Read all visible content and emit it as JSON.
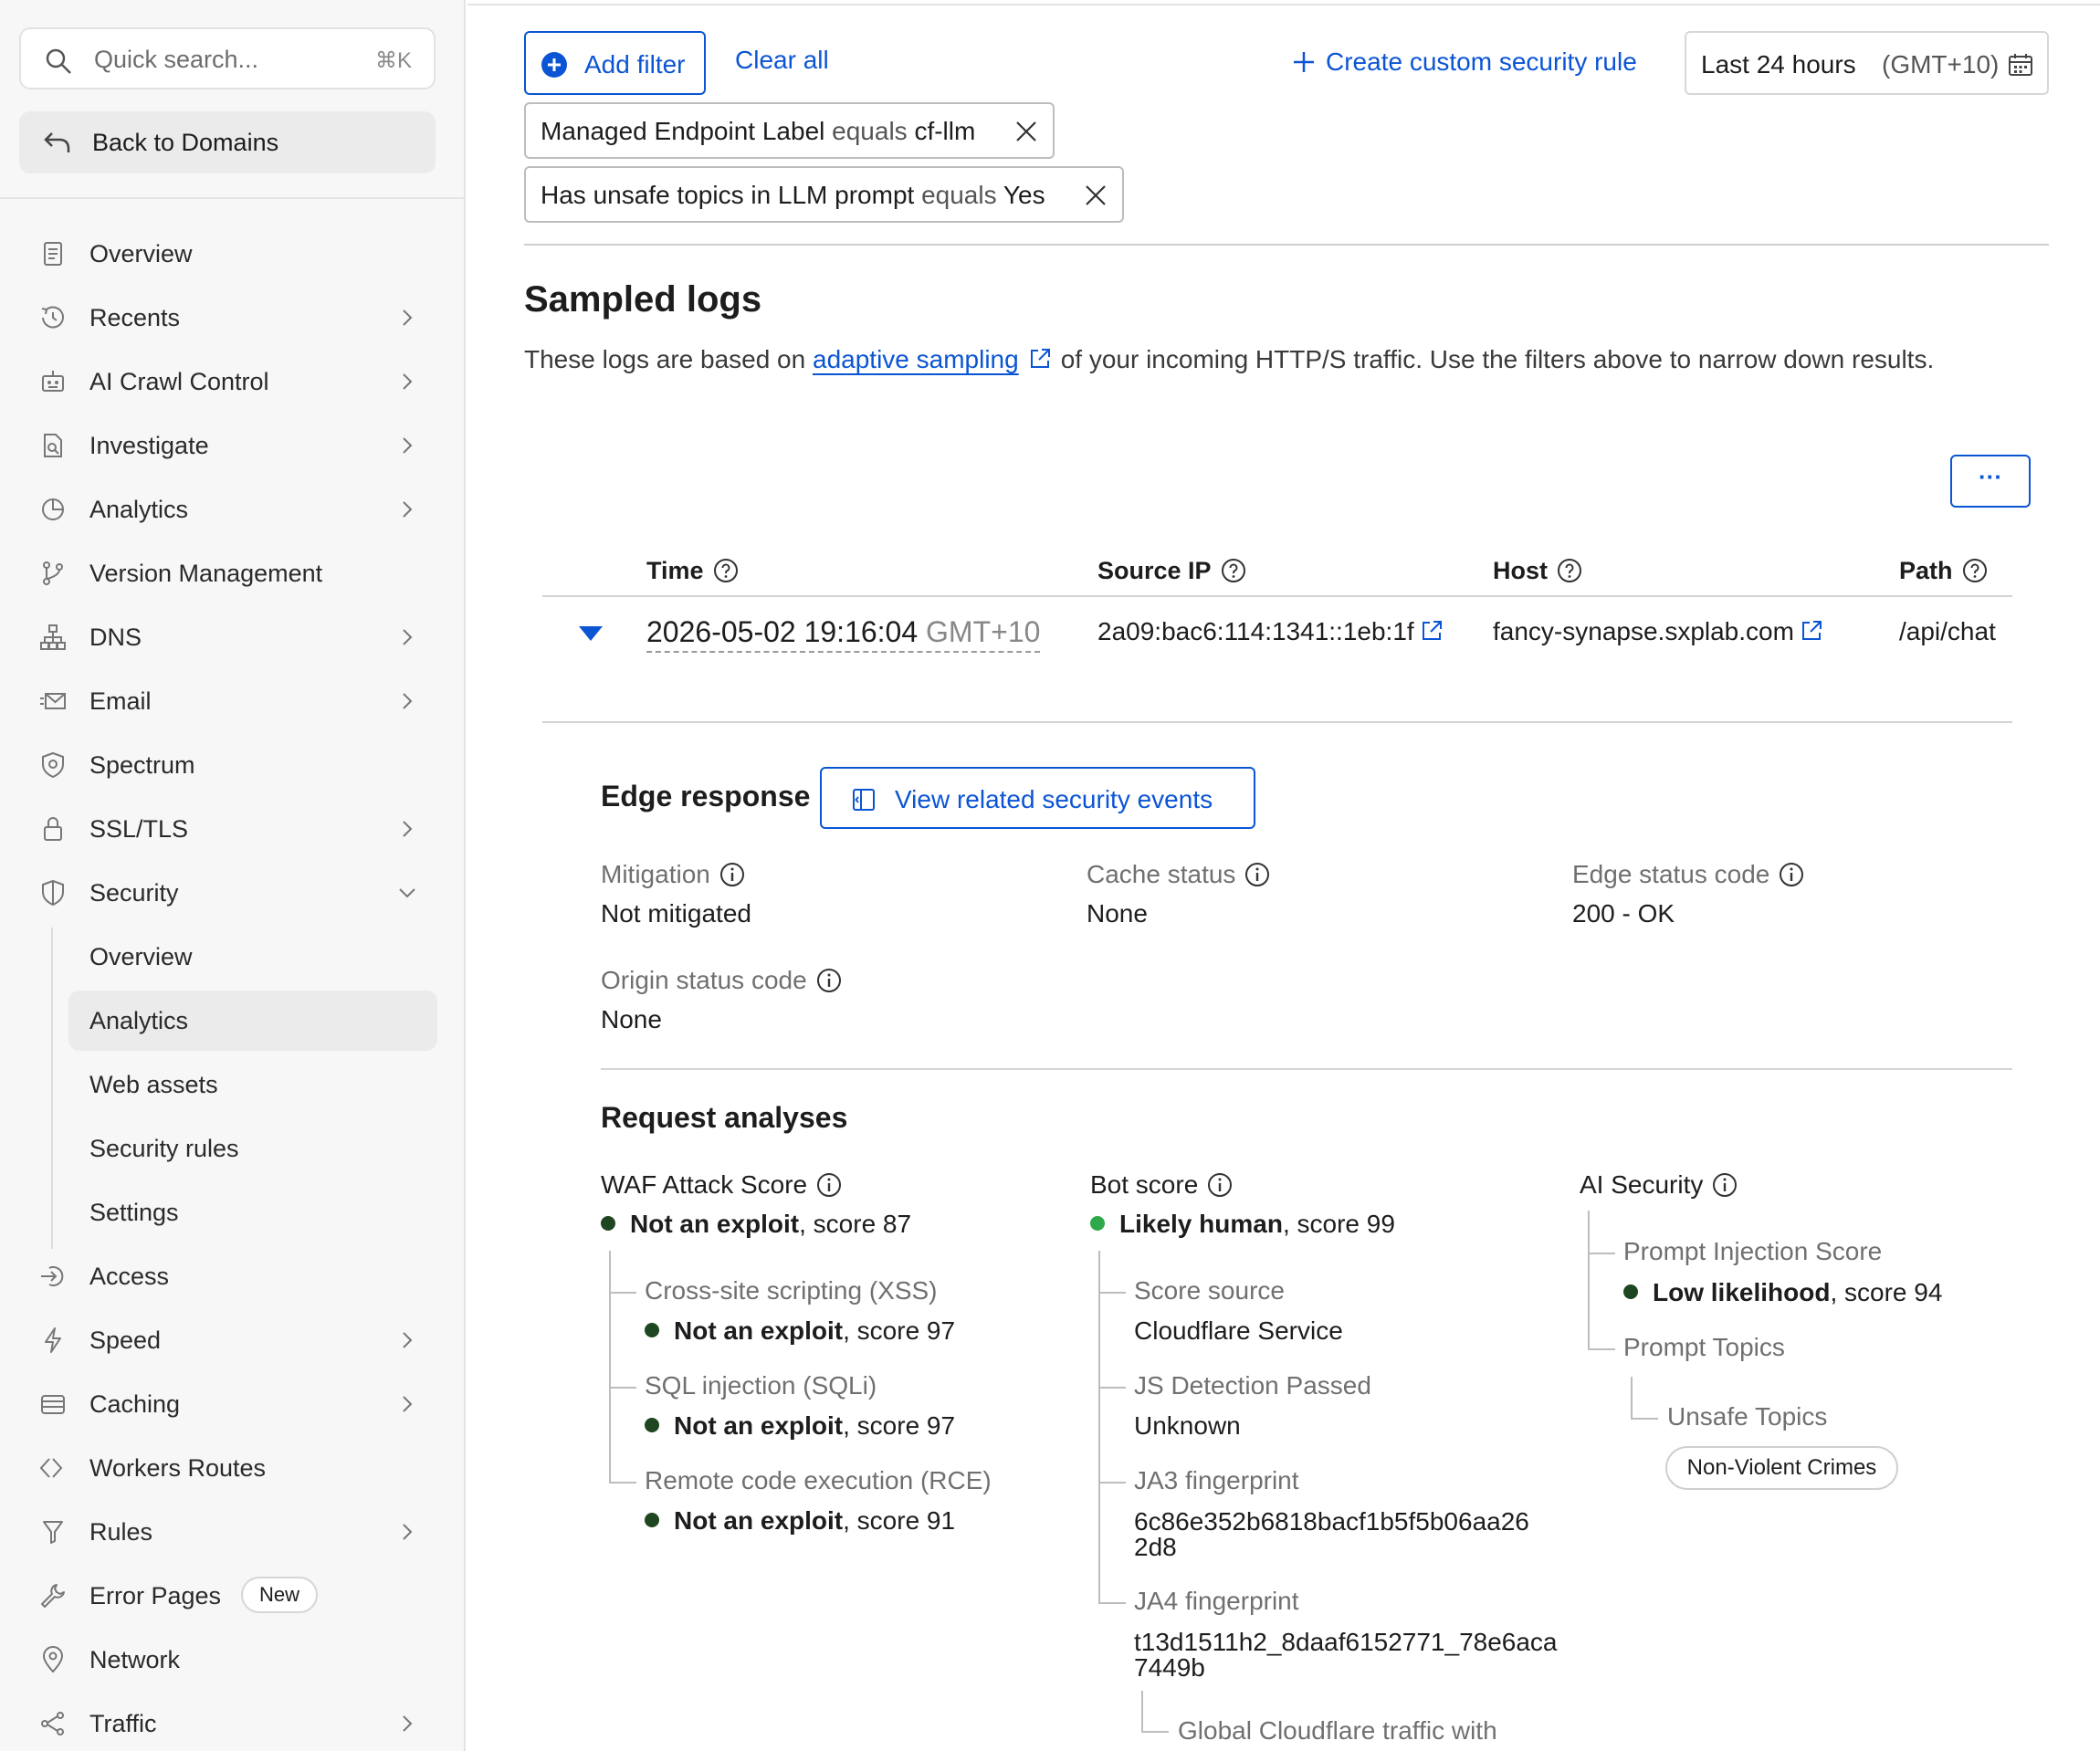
{
  "sidebar": {
    "search": {
      "placeholder": "Quick search...",
      "shortcut": "⌘K"
    },
    "back_label": "Back to Domains",
    "items": [
      {
        "label": "Overview",
        "icon": "document-icon"
      },
      {
        "label": "Recents",
        "icon": "history-icon"
      },
      {
        "label": "AI Crawl Control",
        "icon": "robot-icon"
      },
      {
        "label": "Investigate",
        "icon": "file-search-icon"
      },
      {
        "label": "Analytics",
        "icon": "pie-chart-icon"
      },
      {
        "label": "Version Management",
        "icon": "branch-icon"
      },
      {
        "label": "DNS",
        "icon": "network-tree-icon"
      },
      {
        "label": "Email",
        "icon": "envelope-icon"
      },
      {
        "label": "Spectrum",
        "icon": "shield-star-icon"
      },
      {
        "label": "SSL/TLS",
        "icon": "lock-icon"
      },
      {
        "label": "Security",
        "icon": "shield-icon"
      },
      {
        "label": "Access",
        "icon": "sign-in-icon"
      },
      {
        "label": "Speed",
        "icon": "lightning-icon"
      },
      {
        "label": "Caching",
        "icon": "database-icon"
      },
      {
        "label": "Workers Routes",
        "icon": "code-brackets-icon"
      },
      {
        "label": "Rules",
        "icon": "funnel-icon"
      },
      {
        "label": "Error Pages",
        "icon": "wrench-icon",
        "badge": "New"
      },
      {
        "label": "Network",
        "icon": "location-pin-icon"
      },
      {
        "label": "Traffic",
        "icon": "share-nodes-icon"
      }
    ],
    "security_sub": [
      "Overview",
      "Analytics",
      "Web assets",
      "Security rules",
      "Settings"
    ],
    "active_sub": "Analytics"
  },
  "toolbar": {
    "add_filter": "Add filter",
    "clear_all": "Clear all",
    "create_rule": "Create custom security rule",
    "time_range": "Last 24 hours",
    "timezone": "(GMT+10)"
  },
  "filters": [
    {
      "key": "Managed Endpoint Label",
      "op": "equals",
      "value": "cf-llm"
    },
    {
      "key": "Has unsafe topics in LLM prompt",
      "op": "equals",
      "value": "Yes"
    }
  ],
  "sampled_logs": {
    "title": "Sampled logs",
    "intro_before": "These logs are based on",
    "intro_link": "adaptive sampling",
    "intro_after": "of your incoming HTTP/S traffic. Use the filters above to narrow down results.",
    "more_label": "···",
    "columns": [
      "Time",
      "Source IP",
      "Host",
      "Path"
    ],
    "row": {
      "time": "2026-05-02 19:16:04",
      "tz": "GMT+10",
      "source_ip": "2a09:bac6:114:1341::1eb:1f",
      "host": "fancy-synapse.sxplab.com",
      "path": "/api/chat"
    }
  },
  "edge_response": {
    "title": "Edge response",
    "related_button": "View related security events",
    "fields": [
      {
        "label": "Mitigation",
        "value": "Not mitigated"
      },
      {
        "label": "Cache status",
        "value": "None"
      },
      {
        "label": "Edge status code",
        "value": "200 - OK"
      },
      {
        "label": "Origin status code",
        "value": "None"
      }
    ]
  },
  "request_analyses": {
    "title": "Request analyses",
    "waf": {
      "label": "WAF Attack Score",
      "verdict": "Not an exploit",
      "score": ", score 87",
      "children": [
        {
          "label": "Cross-site scripting (XSS)",
          "verdict": "Not an exploit",
          "score": ", score 97"
        },
        {
          "label": "SQL injection (SQLi)",
          "verdict": "Not an exploit",
          "score": ", score 97"
        },
        {
          "label": "Remote code execution (RCE)",
          "verdict": "Not an exploit",
          "score": ", score 91"
        }
      ]
    },
    "bot": {
      "label": "Bot score",
      "verdict": "Likely human",
      "score": ", score 99",
      "children": [
        {
          "label": "Score source",
          "value": "Cloudflare Service"
        },
        {
          "label": "JS Detection Passed",
          "value": "Unknown"
        },
        {
          "label": "JA3 fingerprint",
          "value_l1": "6c86e352b6818bacf1b5f5b06aa26",
          "value_l2": "2d8"
        },
        {
          "label": "JA4 fingerprint",
          "value_l1": "t13d1511h2_8daaf6152771_78e6aca",
          "value_l2": "7449b"
        }
      ],
      "ja4_child": "Global Cloudflare traffic with"
    },
    "ai": {
      "label": "AI Security",
      "prompt_injection_label": "Prompt Injection Score",
      "prompt_injection_verdict": "Low likelihood",
      "prompt_injection_score": ", score 94",
      "prompt_topics_label": "Prompt Topics",
      "unsafe_topics_label": "Unsafe Topics",
      "unsafe_topic_tag": "Non-Violent Crimes"
    }
  },
  "colors": {
    "accent": "#0b55d4",
    "dark_dot": "#1e4620",
    "green_dot": "#2ea84a"
  }
}
